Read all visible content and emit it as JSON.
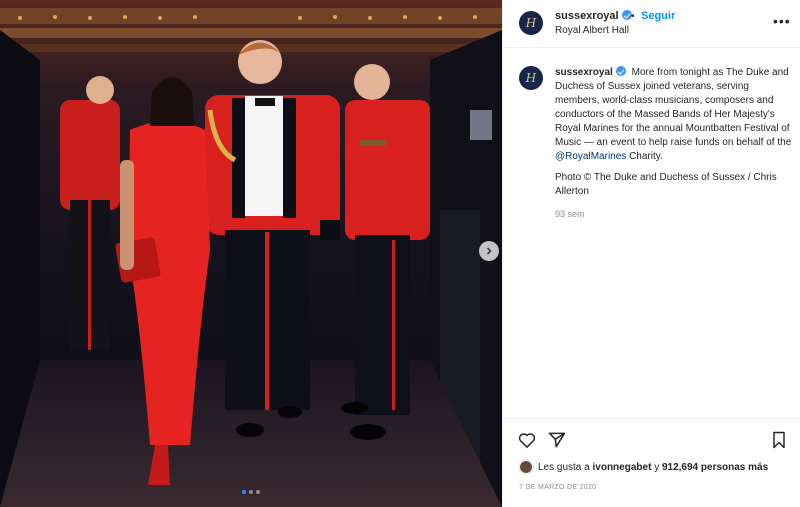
{
  "post": {
    "username": "sussexroyal",
    "verified": true,
    "follow_label": "Seguir",
    "separator": "•",
    "location": "Royal Albert Hall",
    "more_icon": "more-horizontal-icon",
    "avatar_letter": "H",
    "brand_color": "#17264a"
  },
  "media": {
    "carousel_count": 3,
    "carousel_index": 0,
    "next_icon": "chevron-right-icon"
  },
  "caption": {
    "username": "sussexroyal",
    "text_before_mention": "More from tonight as The Duke and Duchess of Sussex joined veterans, serving members, world-class musicians, composers and conductors of the Massed Bands of Her Majesty's Royal Marines for the annual Mountbatten Festival of Music — an event to help raise funds on behalf of the",
    "mention": "@RoyalMarines",
    "text_after_mention": "Charity.",
    "credit": "Photo © The Duke and Duchess of Sussex / Chris Allerton",
    "time_ago": "93 sem"
  },
  "actions": {
    "like_icon": "heart-icon",
    "share_icon": "send-icon",
    "save_icon": "bookmark-icon"
  },
  "likes": {
    "prefix": "Les gusta a",
    "first_user": "ivonnegabet",
    "joiner": "y",
    "count": "912,694",
    "suffix": "personas más"
  },
  "date": "7 DE MARZO DE 2020",
  "colors": {
    "link_blue": "#0095f6",
    "mention_blue": "#00376b",
    "muted_text": "#8e8e8e",
    "uniform_red": "#d8201e",
    "dress_red": "#e52421"
  }
}
